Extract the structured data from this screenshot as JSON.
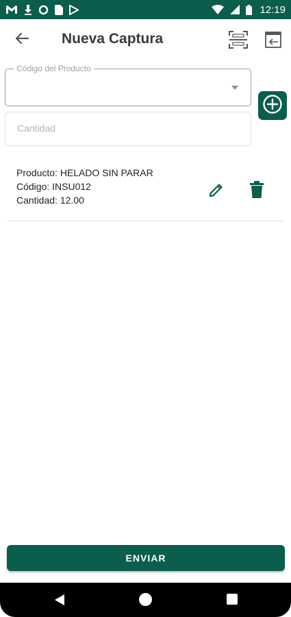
{
  "status_bar": {
    "time": "12:19",
    "icons": [
      "gmail-icon",
      "download-icon",
      "circle-icon",
      "sim-icon",
      "play-store-icon",
      "wifi-icon",
      "signal-icon",
      "battery-icon"
    ]
  },
  "app_bar": {
    "title": "Nueva Captura",
    "back_icon": "arrow-left-icon",
    "scan_icon": "barcode-scan-icon",
    "exit_icon": "exit-icon"
  },
  "form": {
    "product_label": "Código del Producto",
    "product_value": "",
    "quantity_placeholder": "Cantidad",
    "quantity_value": "",
    "add_icon": "plus-circle-icon"
  },
  "items": [
    {
      "product": "Producto: HELADO SIN PARAR",
      "code": "Código: INSU012",
      "quantity": "Cantidad: 12.00"
    }
  ],
  "send_label": "ENVIAR",
  "colors": {
    "primary": "#0b5d4d",
    "status_bar": "#0b5d4d",
    "text": "#212121",
    "hint": "#b4b4b4"
  }
}
